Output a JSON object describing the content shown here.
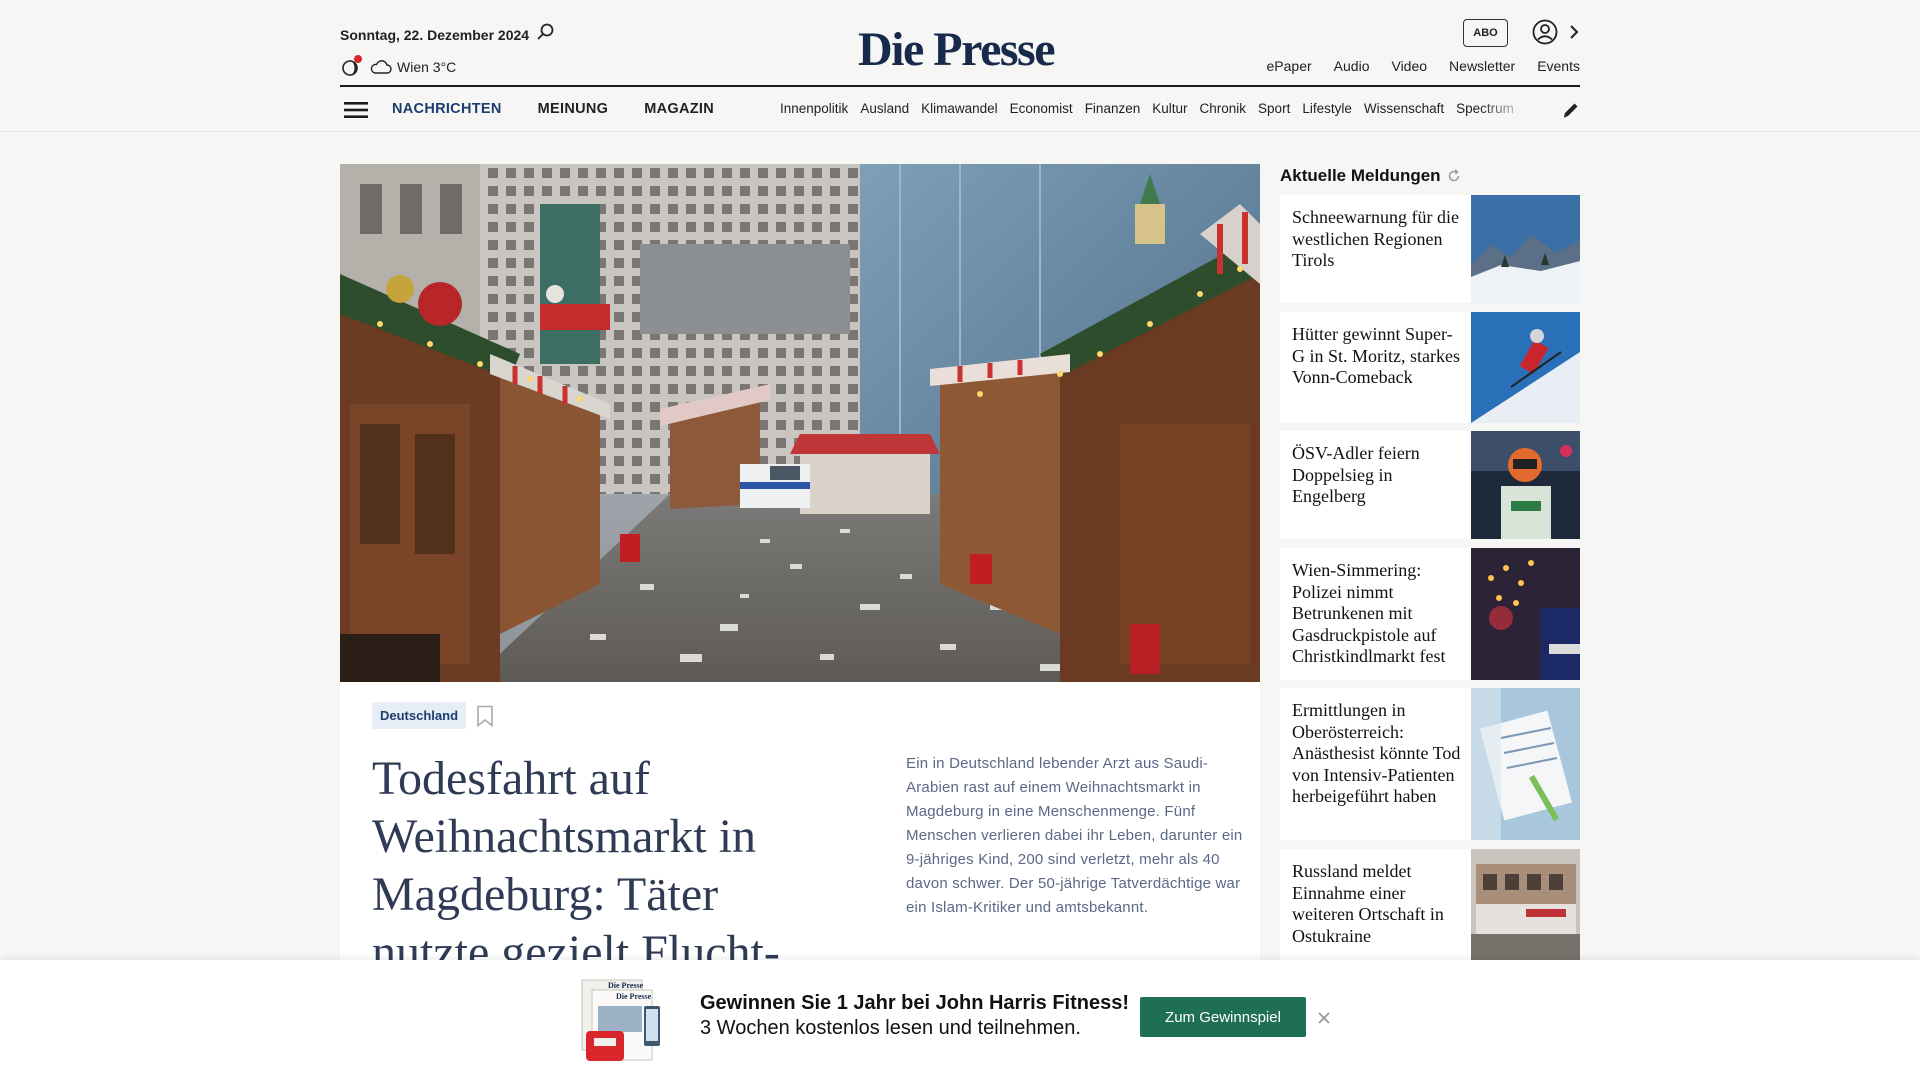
{
  "header": {
    "date": "Sonntag, 22. Dezember 2024",
    "weather": "Wien 3°C",
    "logo": "Die Presse",
    "abo_label": "ABO",
    "top_links": [
      "ePaper",
      "Audio",
      "Video",
      "Newsletter",
      "Events"
    ],
    "main_nav": [
      "NACHRICHTEN",
      "MEINUNG",
      "MAGAZIN"
    ],
    "sub_nav": [
      "Innenpolitik",
      "Ausland",
      "Klimawandel",
      "Economist",
      "Finanzen",
      "Kultur",
      "Chronik",
      "Sport",
      "Lifestyle",
      "Wissenschaft",
      "Spectrum"
    ]
  },
  "hero": {
    "kicker": "Deutschland",
    "headline": "Todesfahrt auf Weihnachtsmarkt in Magdeburg: Täter nutzte gezielt Flucht-",
    "teaser": "Ein in Deutschland lebender Arzt aus Saudi-Arabien rast auf einem Weihnachtsmarkt in Magdeburg in eine Menschenmenge. Fünf Menschen verlieren dabei ihr Leben, darunter ein 9-jähriges Kind, 200 sind verletzt, mehr als 40 davon schwer. Der 50-jährige Tatverdächtige war ein Islam-Kritiker und amtsbekannt."
  },
  "sidebar": {
    "title": "Aktuelle Meldungen",
    "items": [
      {
        "text": "Schneewarnung für die westlichen Regionen Tirols"
      },
      {
        "text": "Hütter gewinnt Super-G in St. Moritz, starkes Vonn-Comeback"
      },
      {
        "text": "ÖSV-Adler feiern Doppelsieg in Engelberg"
      },
      {
        "text": "Wien-Simmering: Polizei nimmt Betrunkenen mit Gasdruckpistole auf Christkindlmarkt fest"
      },
      {
        "text": "Ermittlungen in Oberösterreich: Anästhesist könnte Tod von Intensiv-Patienten herbeigeführt haben"
      },
      {
        "text": "Russland meldet Einnahme einer weiteren Ortschaft in Ostukraine"
      }
    ]
  },
  "promo": {
    "line1": "Gewinnen Sie 1 Jahr bei John Harris Fitness!",
    "line2": "3 Wochen kostenlos lesen und teilnehmen.",
    "button": "Zum Gewinnspiel",
    "paper_label": "Die Presse"
  },
  "colors": {
    "brand_navy": "#172a4b",
    "nav_active": "#1c3e6e",
    "promo_button": "#1f6e56",
    "notification_dot": "#d6262b"
  }
}
